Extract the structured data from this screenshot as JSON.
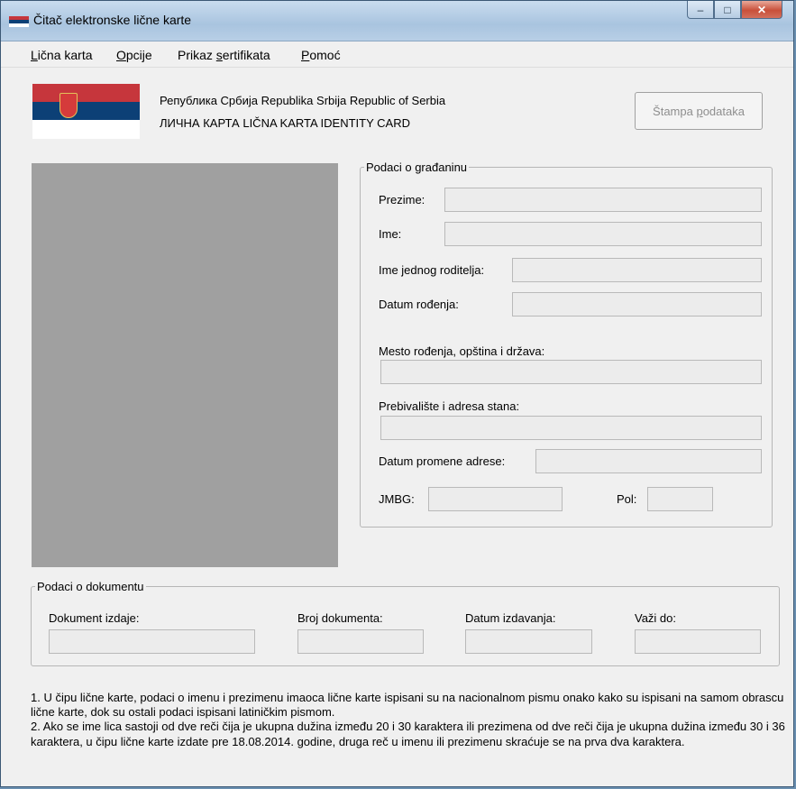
{
  "window": {
    "title": "Čitač elektronske lične karte",
    "controls": {
      "minimize": "‒",
      "maximize": "□",
      "close": "✕"
    }
  },
  "menu": {
    "items": [
      {
        "pre": "",
        "u": "L",
        "post": "ična karta"
      },
      {
        "pre": "",
        "u": "O",
        "post": "pcije"
      },
      {
        "pre": "Prikaz ",
        "u": "s",
        "post": "ertifikata"
      },
      {
        "pre": "",
        "u": "P",
        "post": "omoć"
      }
    ]
  },
  "header": {
    "line1": "Република Србија   Republika Srbija   Republic of Serbia",
    "line2": "ЛИЧНА КАРТА   LIČNA KARTA   IDENTITY CARD",
    "print_pre": "Štampa ",
    "print_u": "p",
    "print_post": "odataka"
  },
  "citizen": {
    "title": "Podaci o građaninu",
    "surname": {
      "label": "Prezime:",
      "value": ""
    },
    "name": {
      "label": "Ime:",
      "value": ""
    },
    "parent": {
      "label": "Ime jednog roditelja:",
      "value": ""
    },
    "birth_date": {
      "label": "Datum rođenja:",
      "value": ""
    },
    "birth_place": {
      "label": "Mesto rođenja, opština i država:",
      "value": ""
    },
    "residence": {
      "label": "Prebivalište i adresa stana:",
      "value": ""
    },
    "address_change": {
      "label": "Datum promene adrese:",
      "value": ""
    },
    "jmbg": {
      "label": "JMBG:",
      "value": ""
    },
    "sex": {
      "label": "Pol:",
      "value": ""
    }
  },
  "document": {
    "title": "Podaci o dokumentu",
    "issuer": {
      "label": "Dokument izdaje:",
      "value": ""
    },
    "number": {
      "label": "Broj dokumenta:",
      "value": ""
    },
    "issue_date": {
      "label": "Datum izdavanja:",
      "value": ""
    },
    "valid_until": {
      "label": "Važi do:",
      "value": ""
    }
  },
  "notes": {
    "note1": "1. U čipu lične karte, podaci o imenu i prezimenu imaoca lične karte ispisani su na nacionalnom pismu onako kako su ispisani na samom obrascu lične karte, dok su ostali podaci ispisani latiničkim pismom.",
    "note2": "2. Ako se ime lica sastoji od dve reči čija je ukupna dužina između 20 i 30 karaktera ili prezimena od dve reči čija je ukupna dužina između 30 i 36 karaktera, u čipu lične karte izdate pre 18.08.2014. godine, druga reč u imenu ili prezimenu skraćuje se na prva dva karaktera."
  },
  "colors": {
    "flag_red": "#c6363c",
    "flag_blue": "#0c4076",
    "flag_white": "#ffffff",
    "photo_placeholder": "#a0a0a0"
  }
}
